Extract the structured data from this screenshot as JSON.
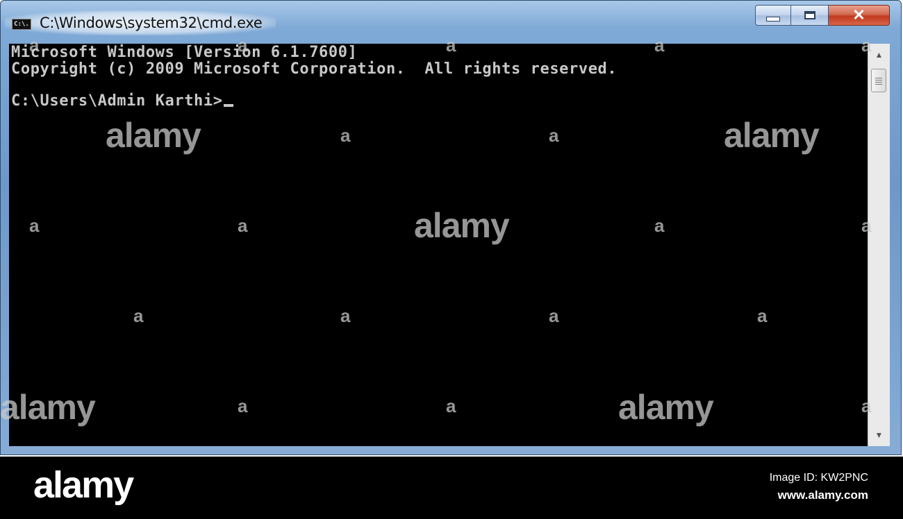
{
  "window": {
    "title": "C:\\Windows\\system32\\cmd.exe",
    "icon_label": "C:\\.",
    "buttons": {
      "minimize": "minimize-icon",
      "maximize": "maximize-icon",
      "close": "close-icon"
    }
  },
  "console": {
    "lines": [
      "Microsoft Windows [Version 6.1.7600]",
      "Copyright (c) 2009 Microsoft Corporation.  All rights reserved.",
      "",
      "C:\\Users\\Admin Karthi>"
    ],
    "background": "#000000",
    "foreground": "#c8c8c8"
  },
  "scrollbar": {
    "up_arrow": "▲",
    "down_arrow": "▼"
  },
  "watermark": {
    "big": "alamy",
    "small": "a"
  },
  "footer": {
    "logo": "alamy",
    "image_id": "Image ID: KW2PNC",
    "url": "www.alamy.com"
  },
  "colors": {
    "frame": "#7fa9d6",
    "close_button": "#c1391c"
  }
}
